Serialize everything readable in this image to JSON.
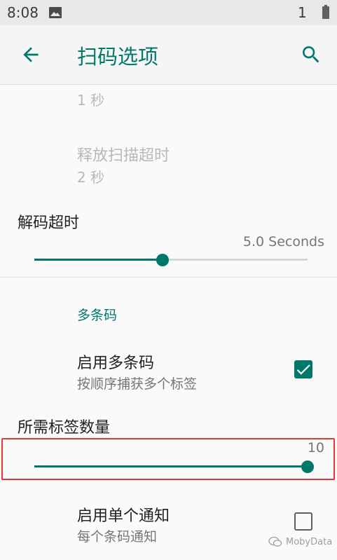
{
  "status_bar": {
    "time": "8:08",
    "sim_count": "1"
  },
  "app_bar": {
    "title": "扫码选项",
    "back_icon": "arrow-back-icon",
    "search_icon": "search-icon"
  },
  "settings": {
    "top_summary": "1 秒",
    "release_scan_timeout": {
      "title": "释放扫描超时",
      "summary": "2 秒"
    },
    "decode_timeout": {
      "title": "解码超时",
      "value_text": "5.0 Seconds",
      "slider_fraction": 0.47
    },
    "multi_barcode_category": "多条码",
    "enable_multi_barcode": {
      "title": "启用多条码",
      "summary": "按顺序捕获多个标签",
      "checked": true
    },
    "required_tag_count": {
      "title": "所需标签数量",
      "value_text": "10",
      "slider_fraction": 1.0
    },
    "enable_single_notification": {
      "title": "启用单个通知",
      "summary": "每个条码通知",
      "checked": false
    }
  },
  "watermark": {
    "text": "MobyData"
  },
  "colors": {
    "accent": "#00796b",
    "highlight": "#e53935"
  }
}
